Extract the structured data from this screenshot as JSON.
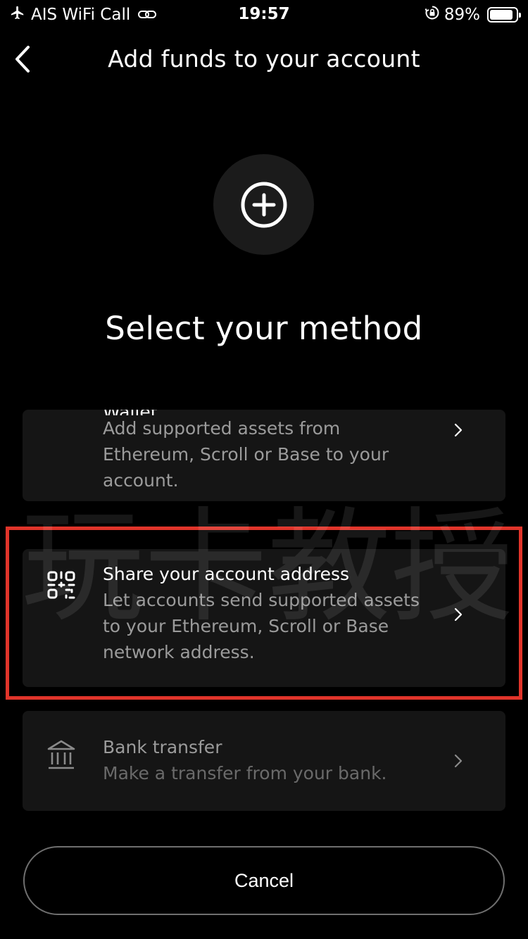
{
  "status_bar": {
    "carrier": "AIS WiFi Call",
    "time": "19:57",
    "battery_percent": "89%",
    "battery_level": 0.89,
    "icons": [
      "airplane-icon",
      "link-icon",
      "orientation-lock-icon",
      "battery-icon"
    ]
  },
  "nav": {
    "title": "Add funds to your account",
    "back_icon": "chevron-left-icon"
  },
  "hero": {
    "icon": "plus-circle-icon"
  },
  "heading": "Select your method",
  "methods": [
    {
      "title": "Wallet",
      "description": "Add supported assets from Ethereum, Scroll or Base to your account.",
      "icon": "chevron-right-icon"
    },
    {
      "title": "Share your account address",
      "description": "Let accounts send supported assets to your Ethereum, Scroll or Base network address.",
      "icon": "qr-code-icon"
    },
    {
      "title": "Bank transfer",
      "description": "Make a transfer from your bank.",
      "icon": "bank-icon"
    }
  ],
  "cancel_label": "Cancel",
  "watermark": "玩卡教授",
  "colors": {
    "background": "#000000",
    "card": "#151515",
    "highlight": "#e0342a",
    "muted_text": "#9b9b9b"
  }
}
